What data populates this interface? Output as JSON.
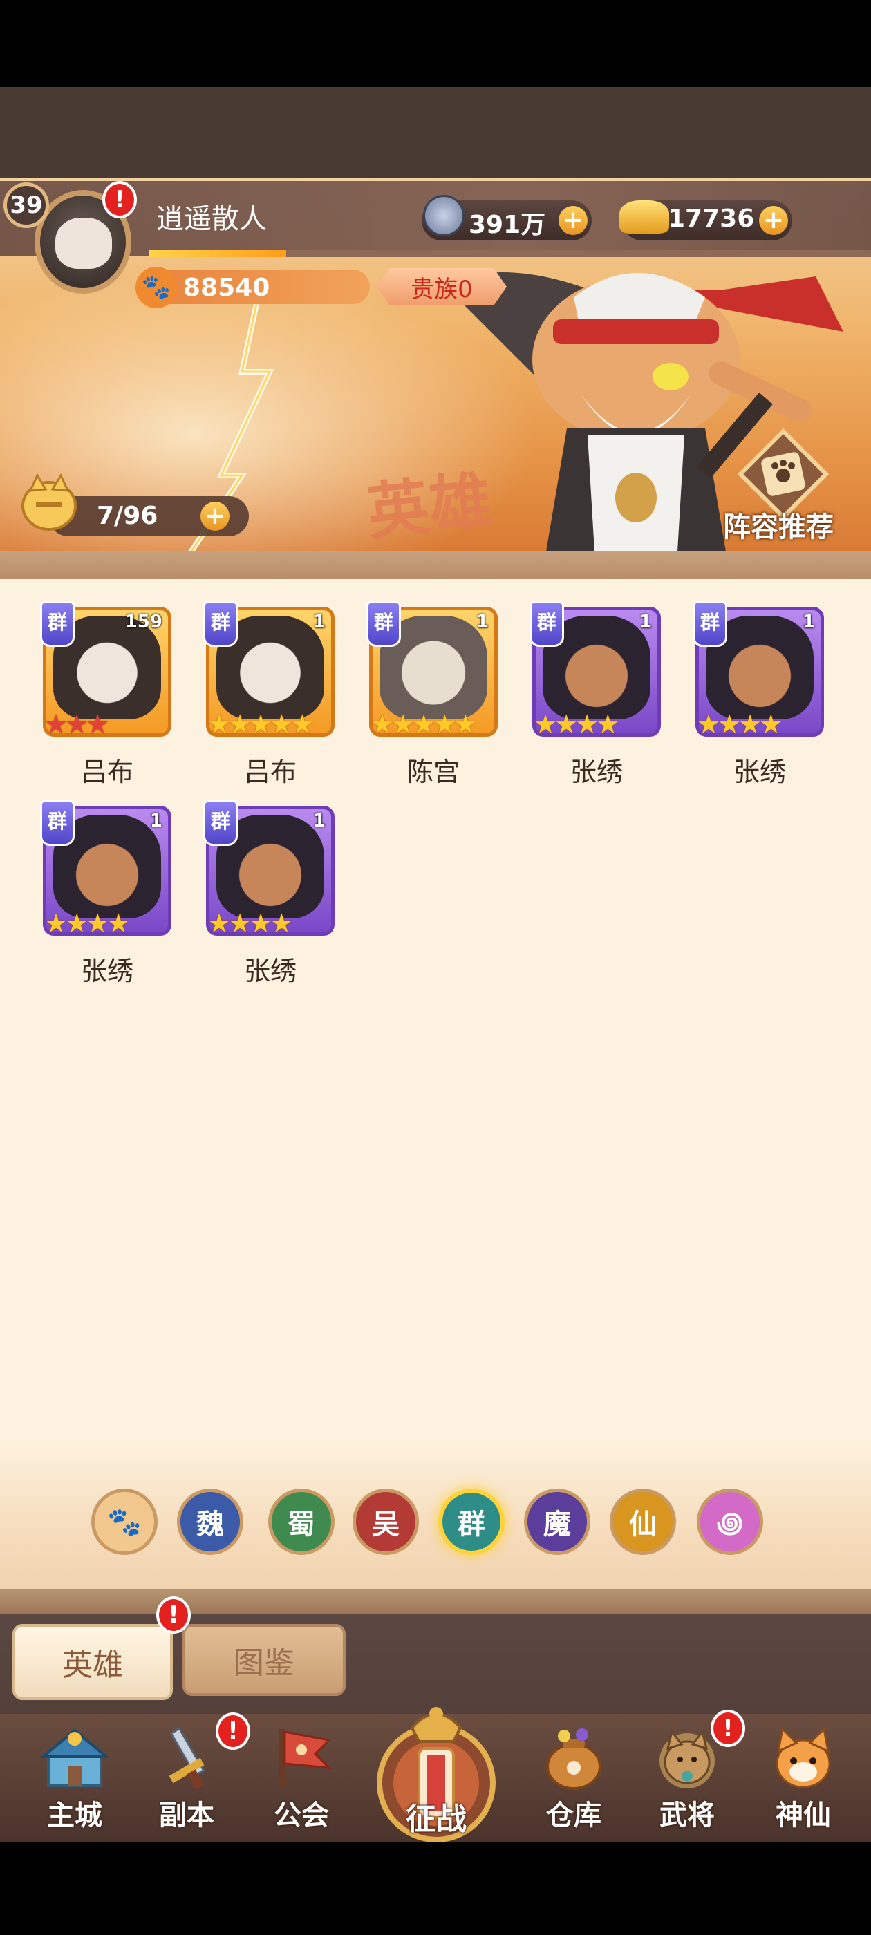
{
  "player": {
    "level": "39",
    "name": "逍遥散人",
    "power": "88540",
    "noble": "贵族0",
    "xp_fraction": 0.19
  },
  "resources": {
    "coins": "391万",
    "gold": "17736"
  },
  "hero_count": "7/96",
  "recommend_label": "阵容推荐",
  "header_watermark": "英雄",
  "alerts": {
    "mark": "!"
  },
  "heroes": [
    {
      "name": "吕布",
      "faction": "群",
      "level": "159",
      "stars": 3,
      "star_color": "red",
      "frame": "orange"
    },
    {
      "name": "吕布",
      "faction": "群",
      "level": "1",
      "stars": 5,
      "star_color": "gold",
      "frame": "orange"
    },
    {
      "name": "陈宫",
      "faction": "群",
      "level": "1",
      "stars": 5,
      "star_color": "gold",
      "frame": "orange"
    },
    {
      "name": "张绣",
      "faction": "群",
      "level": "1",
      "stars": 4,
      "star_color": "gold",
      "frame": "purple"
    },
    {
      "name": "张绣",
      "faction": "群",
      "level": "1",
      "stars": 4,
      "star_color": "gold",
      "frame": "purple"
    },
    {
      "name": "张绣",
      "faction": "群",
      "level": "1",
      "stars": 4,
      "star_color": "gold",
      "frame": "purple"
    },
    {
      "name": "张绣",
      "faction": "群",
      "level": "1",
      "stars": 4,
      "star_color": "gold",
      "frame": "purple"
    }
  ],
  "factions": [
    {
      "label": "",
      "icon": "paw-icon",
      "color": "#f3c88e"
    },
    {
      "label": "魏",
      "color": "#3b5ba8"
    },
    {
      "label": "蜀",
      "color": "#3f8a4e"
    },
    {
      "label": "吴",
      "color": "#b33a35"
    },
    {
      "label": "群",
      "color": "#2f8d87",
      "selected": true
    },
    {
      "label": "魔",
      "color": "#5b3d9c"
    },
    {
      "label": "仙",
      "color": "#d8951f"
    },
    {
      "label": "",
      "icon": "swirl-icon",
      "color": "#d46ac8"
    }
  ],
  "tabs": {
    "hero": "英雄",
    "gallery": "图鉴"
  },
  "nav": {
    "main_city": "主城",
    "dungeon": "副本",
    "guild": "公会",
    "battle": "征战",
    "warehouse": "仓库",
    "generals": "武将",
    "immortal": "神仙"
  },
  "colors": {
    "accent_orange": "#f59a25",
    "alert_red": "#e3211f",
    "content_bg": "#fdf2df"
  }
}
